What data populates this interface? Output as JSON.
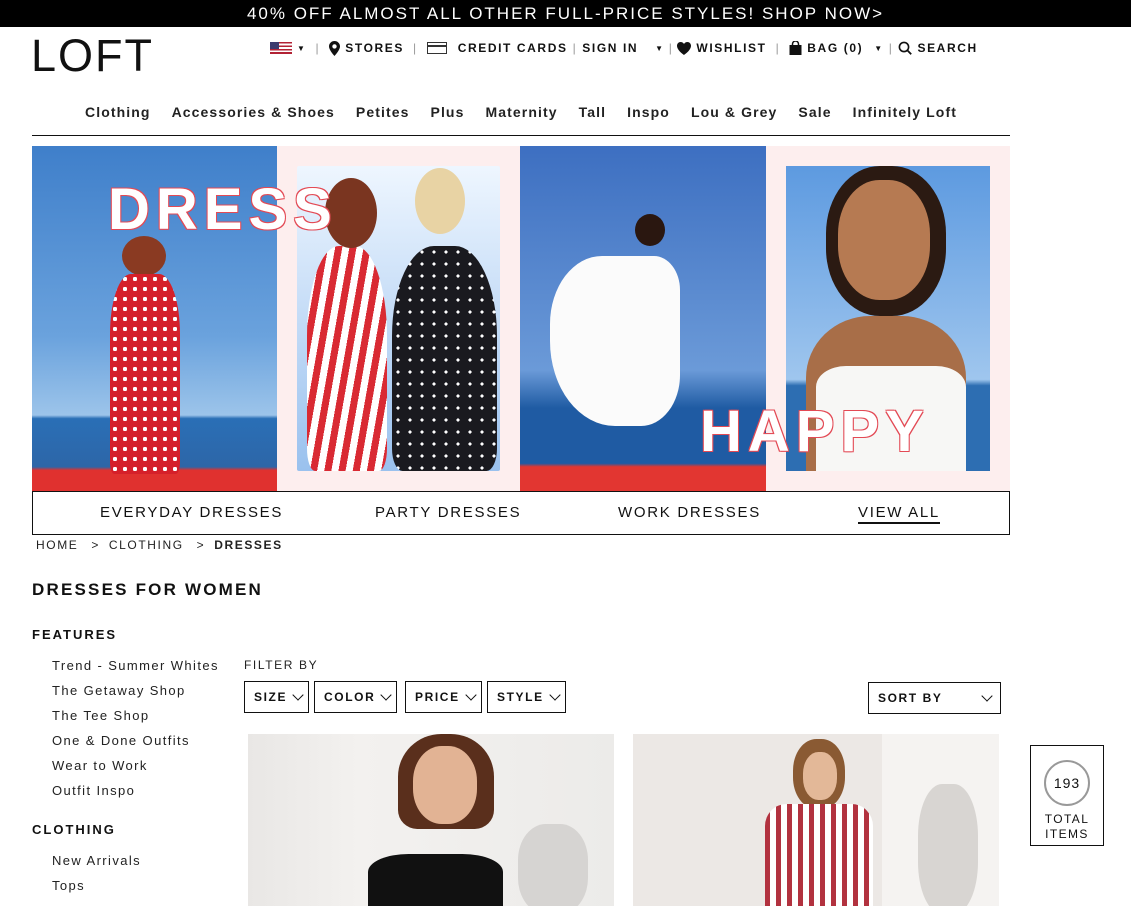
{
  "promo": {
    "text": "40% OFF ALMOST ALL OTHER FULL-PRICE STYLES! SHOP NOW>"
  },
  "brand": {
    "logo": "LOFT"
  },
  "utility": {
    "stores": "STORES",
    "credit_cards": "CREDIT CARDS",
    "sign_in": "SIGN IN",
    "wishlist": "WISHLIST",
    "bag": "BAG",
    "bag_count": "(0)",
    "search": "SEARCH",
    "icons": [
      "us-flag-icon",
      "location-pin-icon",
      "credit-card-icon",
      "heart-icon",
      "shopping-bag-icon",
      "search-icon"
    ]
  },
  "nav": [
    {
      "label": "Clothing"
    },
    {
      "label": "Accessories & Shoes"
    },
    {
      "label": "Petites"
    },
    {
      "label": "Plus"
    },
    {
      "label": "Maternity"
    },
    {
      "label": "Tall"
    },
    {
      "label": "Inspo"
    },
    {
      "label": "Lou & Grey"
    },
    {
      "label": "Sale"
    },
    {
      "label": "Infinitely Loft"
    }
  ],
  "hero": {
    "word_1": "DRESS",
    "word_2": "HAPPY"
  },
  "categories": [
    {
      "label": "EVERYDAY DRESSES"
    },
    {
      "label": "PARTY DRESSES"
    },
    {
      "label": "WORK DRESSES"
    },
    {
      "label": "VIEW ALL"
    }
  ],
  "breadcrumb": {
    "home": "HOME",
    "sep1": ">",
    "clothing": "CLOTHING",
    "sep2": ">",
    "current": "DRESSES"
  },
  "page_title": "DRESSES FOR WOMEN",
  "sidebar": {
    "features_heading": "FEATURES",
    "features": [
      "Trend - Summer Whites",
      "The Getaway Shop",
      "The Tee Shop",
      "One & Done Outfits",
      "Wear to Work",
      "Outfit Inspo"
    ],
    "clothing_heading": "CLOTHING",
    "clothing": [
      "New Arrivals",
      "Tops"
    ]
  },
  "filters": {
    "label": "FILTER BY",
    "buttons": [
      "SIZE",
      "COLOR",
      "PRICE",
      "STYLE"
    ],
    "sort_label": "SORT BY"
  },
  "results": {
    "count": "193",
    "label_1": "TOTAL",
    "label_2": "ITEMS"
  }
}
